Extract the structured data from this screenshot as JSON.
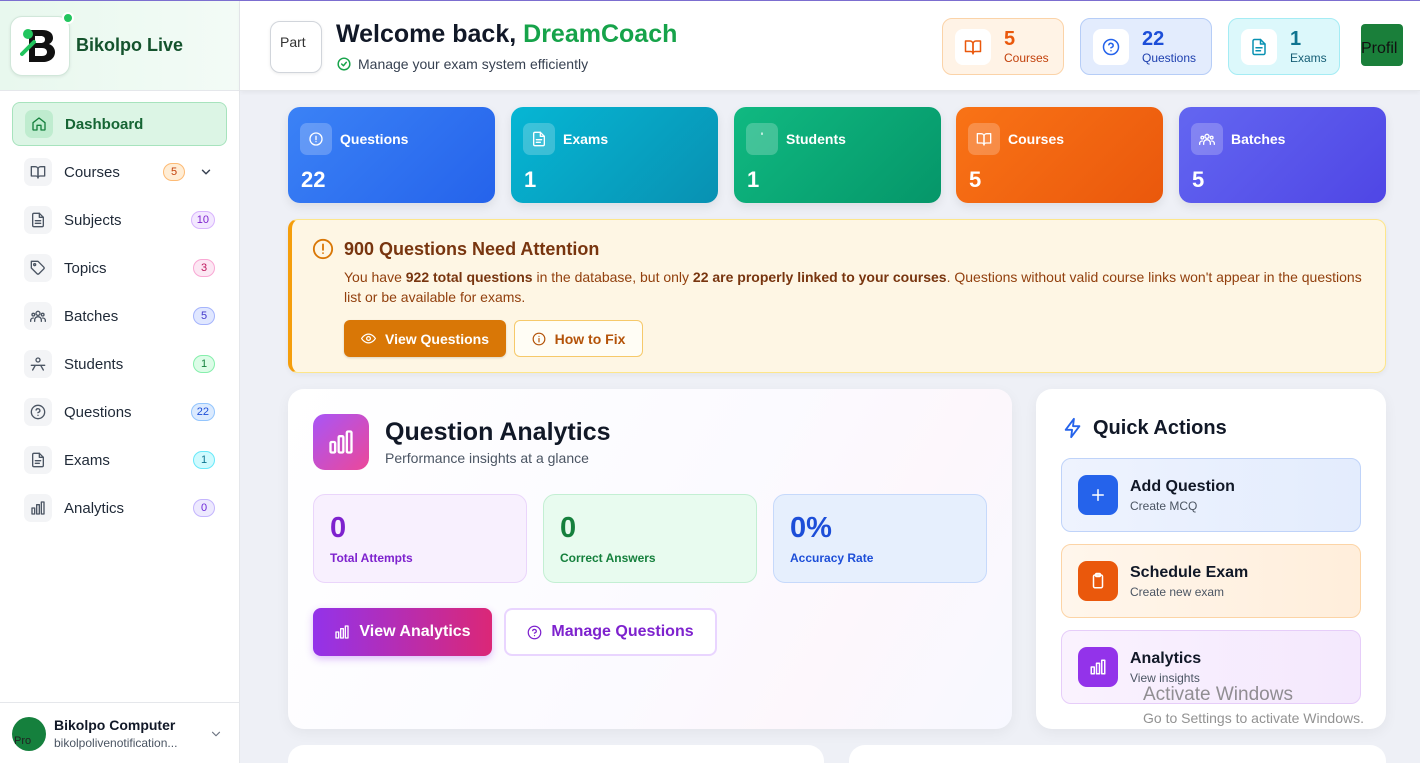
{
  "brand": {
    "name": "Bikolpo Live"
  },
  "sidebar": {
    "items": [
      {
        "label": "Dashboard",
        "badge": ""
      },
      {
        "label": "Courses",
        "badge": "5"
      },
      {
        "label": "Subjects",
        "badge": "10"
      },
      {
        "label": "Topics",
        "badge": "3"
      },
      {
        "label": "Batches",
        "badge": "5"
      },
      {
        "label": "Students",
        "badge": "1"
      },
      {
        "label": "Questions",
        "badge": "22"
      },
      {
        "label": "Exams",
        "badge": "1"
      },
      {
        "label": "Analytics",
        "badge": "0"
      }
    ]
  },
  "user": {
    "name": "Bikolpo Computer",
    "email": "bikolpolivenotification...",
    "avatar_alt": "Pro"
  },
  "header": {
    "logo_alt": "Part",
    "welcome": "Welcome back,",
    "name": "DreamCoach",
    "subtitle": "Manage your exam system efficiently",
    "pills": [
      {
        "value": "5",
        "label": "Courses"
      },
      {
        "value": "22",
        "label": "Questions"
      },
      {
        "value": "1",
        "label": "Exams"
      }
    ],
    "profile_alt": "Profil"
  },
  "stats": [
    {
      "label": "Questions",
      "value": "22"
    },
    {
      "label": "Exams",
      "value": "1"
    },
    {
      "label": "Students",
      "value": "1"
    },
    {
      "label": "Courses",
      "value": "5"
    },
    {
      "label": "Batches",
      "value": "5"
    }
  ],
  "alert": {
    "title": "900 Questions Need Attention",
    "t1": "You have ",
    "b1": "922 total questions",
    "t2": " in the database, but only ",
    "b2": "22 are properly linked to your courses",
    "t3": ". Questions without valid course links won't appear in the questions list or be available for exams.",
    "view_btn": "View Questions",
    "fix_btn": "How to Fix"
  },
  "analytics": {
    "title": "Question Analytics",
    "subtitle": "Performance insights at a glance",
    "metrics": [
      {
        "value": "0",
        "label": "Total Attempts"
      },
      {
        "value": "0",
        "label": "Correct Answers"
      },
      {
        "value": "0%",
        "label": "Accuracy Rate"
      }
    ],
    "view_btn": "View Analytics",
    "manage_btn": "Manage Questions"
  },
  "quick_actions": {
    "title": "Quick Actions",
    "items": [
      {
        "title": "Add Question",
        "desc": "Create MCQ"
      },
      {
        "title": "Schedule Exam",
        "desc": "Create new exam"
      },
      {
        "title": "Analytics",
        "desc": "View insights"
      }
    ]
  },
  "watermark": {
    "line1": "Activate Windows",
    "line2": "Go to Settings to activate Windows."
  },
  "colors": {
    "brand_green": "#16a34a",
    "amber": "#d97706",
    "purple": "#9333ea"
  }
}
